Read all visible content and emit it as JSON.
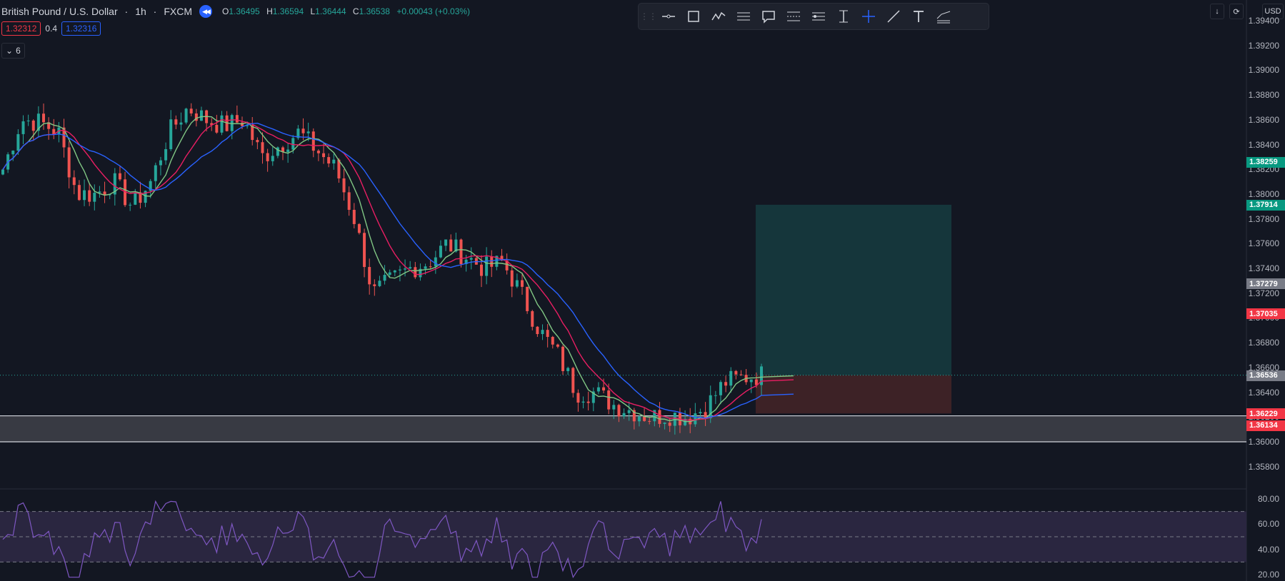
{
  "header": {
    "symbol": "British Pound / U.S. Dollar",
    "interval": "1h",
    "source": "FXCM",
    "open_label": "O",
    "open": "1.36495",
    "high_label": "H",
    "high": "1.36594",
    "low_label": "L",
    "low": "1.36444",
    "close_label": "C",
    "close": "1.36538",
    "change": "+0.00043 (+0.03%)"
  },
  "trade": {
    "sell_price": "1.32312",
    "spread": "0.4",
    "buy_price": "1.32316"
  },
  "indicators_toggle": {
    "count": "6"
  },
  "currency_button": "USD",
  "toolbar": {
    "tools": [
      "grip-icon",
      "horizontal-line-icon",
      "rectangle-icon",
      "path-icon",
      "parallel-channel-icon",
      "callout-icon",
      "fib-retracement-icon",
      "fib-extension-icon",
      "price-range-icon",
      "crosshair-icon",
      "trend-line-icon",
      "text-icon",
      "multi-line-icon"
    ]
  },
  "price_axis": {
    "ticks": [
      "1.39400",
      "1.39200",
      "1.39000",
      "1.38800",
      "1.38600",
      "1.38400",
      "1.38200",
      "1.38000",
      "1.37800",
      "1.37600",
      "1.37400",
      "1.37200",
      "1.37000",
      "1.36800",
      "1.36600",
      "1.36400",
      "1.36200",
      "1.36000",
      "1.35800"
    ],
    "tags": [
      {
        "value": "1.38259",
        "color": "#089981"
      },
      {
        "value": "1.37914",
        "color": "#089981"
      },
      {
        "value": "1.37279",
        "color": "#787b86"
      },
      {
        "value": "1.37035",
        "color": "#f23645"
      },
      {
        "value": "1.36538",
        "color": "#089981"
      },
      {
        "value": "1.36536",
        "color": "#787b86"
      },
      {
        "value": "1.36229",
        "color": "#f23645"
      },
      {
        "value": "1.36134",
        "color": "#f23645"
      }
    ]
  },
  "rsi_axis": {
    "ticks": [
      "80.00",
      "60.00",
      "40.00",
      "20.00"
    ]
  },
  "colors": {
    "up": "#26a69a",
    "down": "#ef5350",
    "ma_fast": "#81c784",
    "ma_mid": "#e91e63",
    "ma_slow": "#2962ff",
    "rsi_line": "#7e57c2",
    "rsi_band": "#2a2640",
    "profit_zone": "#15363b",
    "loss_zone": "#3d2226",
    "support_zone": "#383a43"
  },
  "chart_data": {
    "type": "candlestick",
    "symbol": "GBPUSD",
    "ylim": [
      1.357,
      1.395
    ],
    "close_path": [
      1.382,
      1.386,
      1.3858,
      1.385,
      1.38,
      1.38,
      1.381,
      1.379,
      1.381,
      1.385,
      1.387,
      1.386,
      1.3855,
      1.386,
      1.383,
      1.384,
      1.385,
      1.3835,
      1.382,
      1.378,
      1.372,
      1.373,
      1.374,
      1.3745,
      1.376,
      1.375,
      1.374,
      1.3745,
      1.372,
      1.369,
      1.367,
      1.364,
      1.364,
      1.363,
      1.3625,
      1.362,
      1.3622,
      1.362,
      1.3628,
      1.3648,
      1.3652,
      1.3654
    ],
    "position": {
      "entry": 1.36538,
      "target": 1.37914,
      "stop": 1.36229
    },
    "support_zone": [
      1.36,
      1.3621
    ],
    "rsi": {
      "ylim": [
        15,
        85
      ],
      "levels": [
        70,
        50,
        30
      ]
    }
  }
}
